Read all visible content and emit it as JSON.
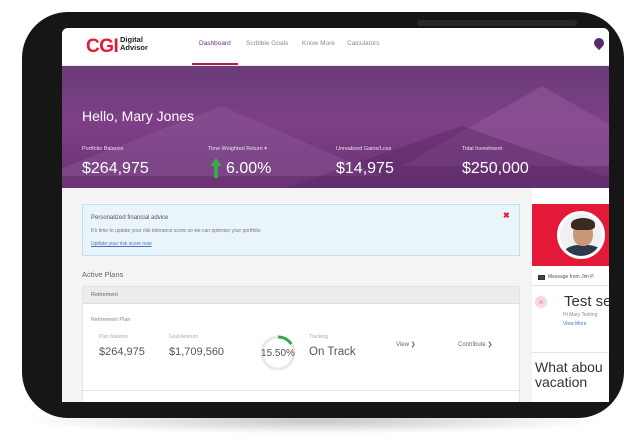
{
  "brand": {
    "logo": "CGI",
    "product_line1": "Digital",
    "product_line2": "Advisor"
  },
  "nav": {
    "items": [
      {
        "label": "Dashboard",
        "active": true
      },
      {
        "label": "Scribble Goals",
        "active": false
      },
      {
        "label": "Know More",
        "active": false
      },
      {
        "label": "Calculators",
        "active": false
      }
    ],
    "icon": "location-pin-icon"
  },
  "hero": {
    "greeting": "Hello, Mary Jones",
    "metrics": [
      {
        "label": "Portfolio Balance",
        "value": "$264,975"
      },
      {
        "label": "Time Weighted Return ▾",
        "value": "6.00%",
        "icon": "arrow-up-icon"
      },
      {
        "label": "Unrealized Gains/Loss",
        "value": "$14,975"
      },
      {
        "label": "Total Investment",
        "value": "$250,000"
      }
    ]
  },
  "advice": {
    "title": "Personalized financial advice",
    "text": "It's time to update your risk tolerance score so we can optimize your portfolio",
    "link": "Update your risk score now",
    "close_icon": "close-icon"
  },
  "plans": {
    "title": "Active Plans",
    "section": "Retirement",
    "plan_name": "Retirement Plan",
    "plan_balance_label": "Plan balance",
    "plan_balance": "$264,975",
    "goal_label": "Goal Amount",
    "goal": "$1,709,560",
    "progress_percent": 15.5,
    "progress_text": "15.50%",
    "tracking_label": "Tracking",
    "tracking": "On Track",
    "view_label": "View ❯",
    "contribute_label": "Contribute ❯"
  },
  "advisor": {
    "message_from": "Message from Jim P.",
    "subject": "Test se",
    "preview": "Hi Mary Testing",
    "view_more": "View More",
    "question_line1": "What abou",
    "question_line2": "vacation"
  },
  "colors": {
    "brand_red": "#e31937",
    "hero_purple": "#7e3f86",
    "accent_green": "#3aa84a",
    "link_blue": "#4a73c2"
  }
}
